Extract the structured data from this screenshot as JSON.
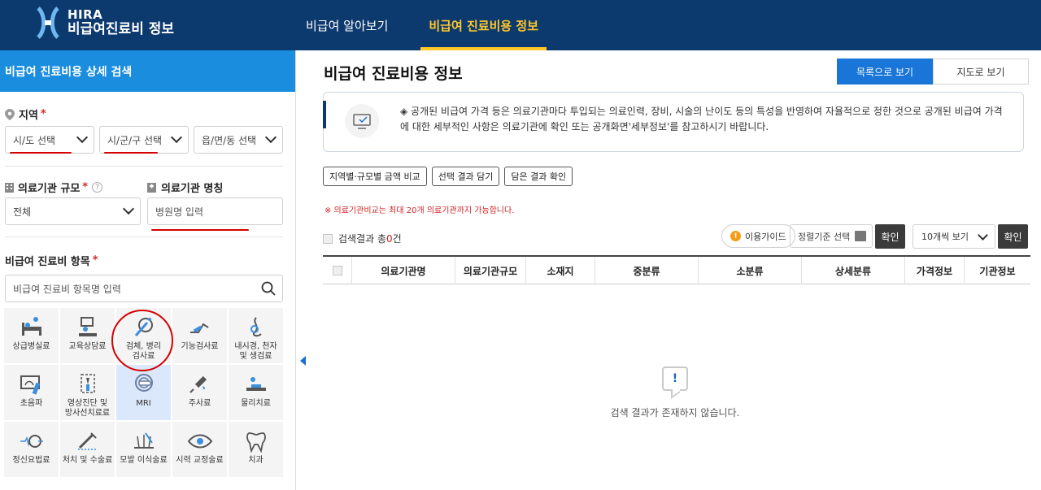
{
  "header": {
    "logo_line1": "HIRA",
    "logo_line2": "비급여진료비 정보",
    "nav": [
      {
        "label": "비급여 알아보기",
        "active": false
      },
      {
        "label": "비급여 진료비용 정보",
        "active": true
      }
    ]
  },
  "left": {
    "title": "비급여 진료비용 상세 검색",
    "region_label": "지역",
    "required_mark": "*",
    "sido_placeholder": "시/도 선택",
    "sigungu_placeholder": "시/군/구 선택",
    "eupmyeon_placeholder": "읍/면/동 선택",
    "scale_label": "의료기관 규모",
    "scale_value": "전체",
    "name_label": "의료기관 명칭",
    "name_placeholder": "병원명 입력",
    "item_label": "비급여 진료비 항목",
    "item_placeholder": "비급여 진료비 항목명 입력",
    "categories": [
      {
        "label": "상급병실료",
        "icon": "hospital-bed-icon"
      },
      {
        "label": "교육상담료",
        "icon": "counseling-icon"
      },
      {
        "label": "검체, 병리\n검사료",
        "icon": "pathology-icon"
      },
      {
        "label": "기능검사료",
        "icon": "function-test-icon"
      },
      {
        "label": "내시경, 천자\n및 생검료",
        "icon": "endoscope-icon"
      },
      {
        "label": "초음파",
        "icon": "ultrasound-icon"
      },
      {
        "label": "영상진단 및\n방사선치료료",
        "icon": "radiology-icon"
      },
      {
        "label": "MRI",
        "icon": "mri-icon"
      },
      {
        "label": "주사료",
        "icon": "syringe-icon"
      },
      {
        "label": "물리치료",
        "icon": "physical-therapy-icon"
      },
      {
        "label": "정신요법료",
        "icon": "brain-icon"
      },
      {
        "label": "처치 및 수술료",
        "icon": "surgery-icon"
      },
      {
        "label": "모발 이식술료",
        "icon": "hair-transplant-icon"
      },
      {
        "label": "시력 교정술료",
        "icon": "eye-icon"
      },
      {
        "label": "치과",
        "icon": "tooth-icon"
      }
    ]
  },
  "right": {
    "title": "비급여 진료비용 정보",
    "list_view": "목록으로 보기",
    "map_view": "지도로 보기",
    "notice": "◈ 공개된 비급여 가격 등은 의료기관마다 투입되는 의료인력, 장비, 시술의 난이도 등의 특성을 반영하여 자율적으로 정한 것으로 공개된 비급여 가격에 대한 세부적인 사항은 의료기관에 확인 또는 공개화면'세부정보'를 참고하시기 바랍니다.",
    "btn_compare": "지역별·규모별 금액 비교",
    "btn_select": "선택 결과 담기",
    "btn_saved": "담은 결과 확인",
    "warn": "※ 의료기관비교는 최대 20개 의료기관까지 가능합니다.",
    "result_prefix": "검색결과 총",
    "result_count": "0",
    "result_suffix": "건",
    "guide": "이용가이드",
    "sort_placeholder": "정렬기준 선택",
    "confirm": "확인",
    "page_size": "10개씩 보기",
    "columns": [
      "의료기관명",
      "의료기관규모",
      "소재지",
      "중분류",
      "소분류",
      "상세분류",
      "가격정보",
      "기관정보"
    ],
    "empty": "검색 결과가 존재하지 않습니다."
  },
  "colors": {
    "header_bg": "#0d3a6e",
    "accent_yellow": "#ffc728",
    "panel_blue": "#1a8ddf",
    "primary_blue": "#1976d8",
    "annotation_red": "#d40000"
  }
}
